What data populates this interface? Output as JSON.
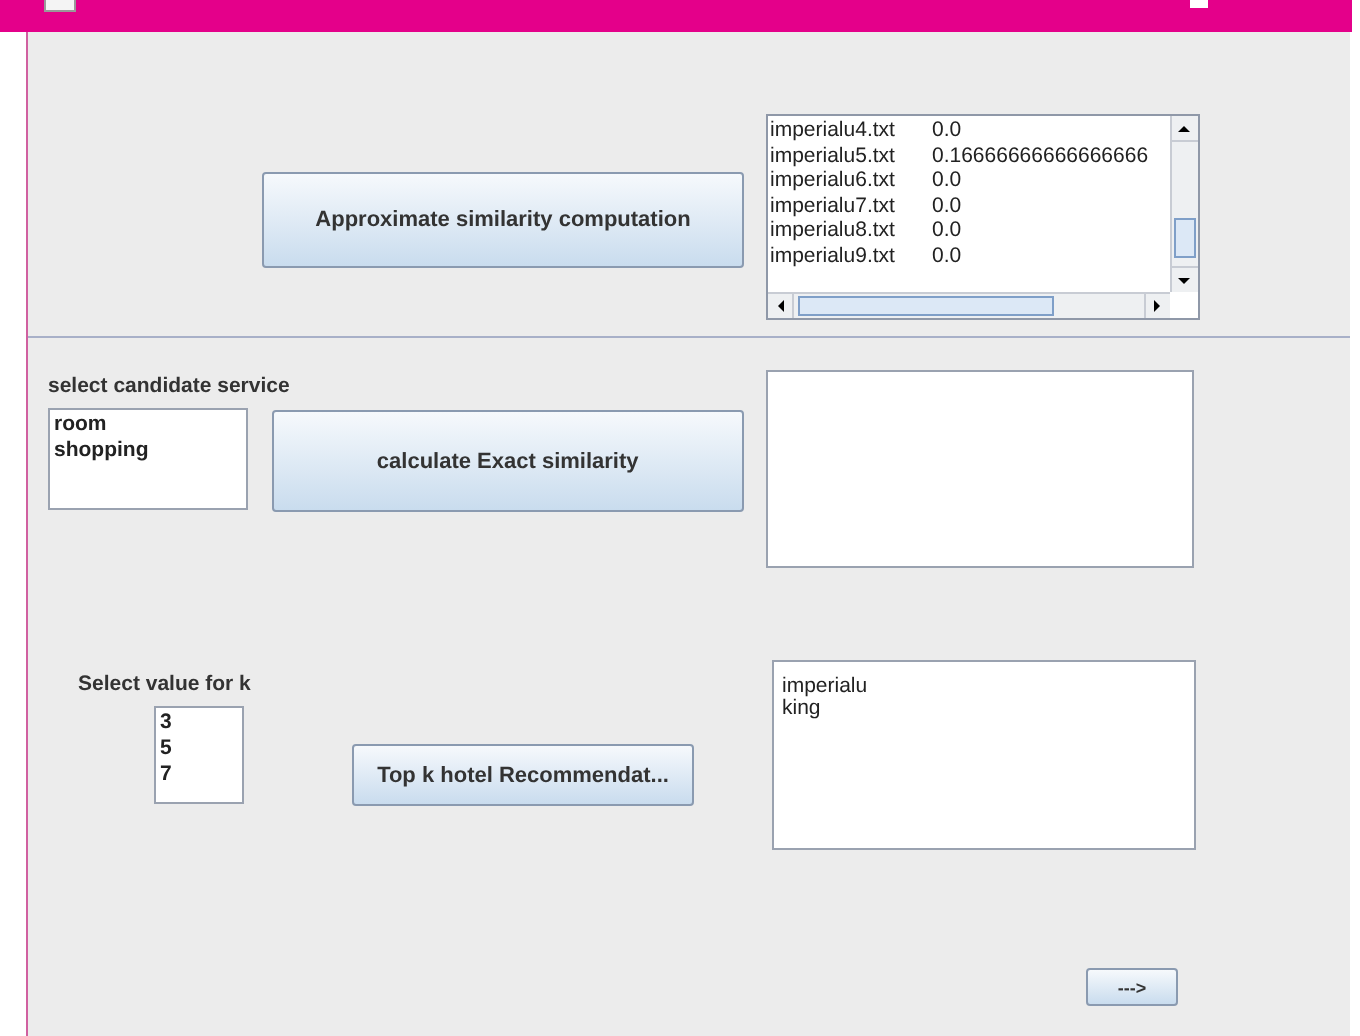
{
  "approximate": {
    "button": "Approximate similarity computation",
    "results": [
      {
        "file": "imperialu4.txt",
        "score": "0.0"
      },
      {
        "file": "imperialu5.txt",
        "score": "0.16666666666666666"
      },
      {
        "file": "imperialu6.txt",
        "score": "0.0"
      },
      {
        "file": "imperialu7.txt",
        "score": "0.0"
      },
      {
        "file": "imperialu8.txt",
        "score": "0.0"
      },
      {
        "file": "imperialu9.txt",
        "score": "0.0"
      }
    ]
  },
  "candidate": {
    "label": "select candidate service",
    "options": [
      {
        "text": "room",
        "selected": false
      },
      {
        "text": "shopping",
        "selected": false
      }
    ],
    "button": "calculate Exact similarity"
  },
  "k": {
    "label": "Select value for k",
    "options": [
      {
        "text": "3",
        "selected": false
      },
      {
        "text": "5",
        "selected": false
      },
      {
        "text": "7",
        "selected": false
      }
    ],
    "button": "Top k hotel Recommendat...",
    "output": [
      "imperialu",
      "king"
    ]
  },
  "next_button": "--->"
}
